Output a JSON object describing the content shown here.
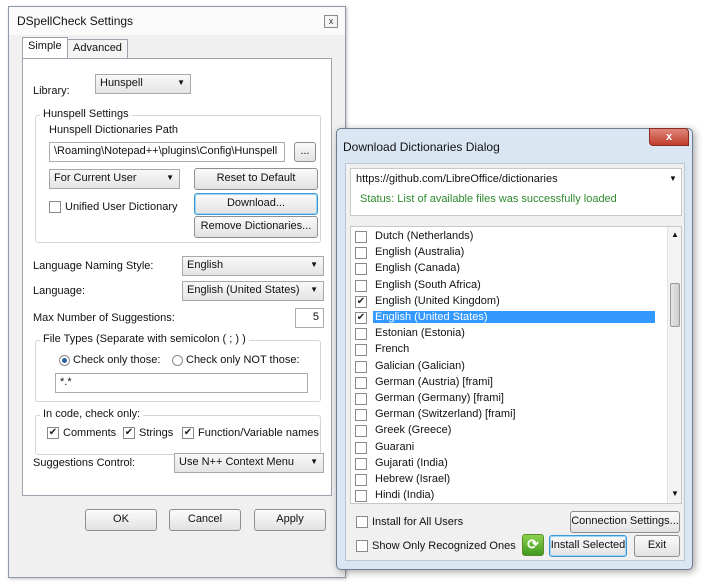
{
  "settings": {
    "title": "DSpellCheck Settings",
    "close_label": "x",
    "tabs": [
      "Simple",
      "Advanced"
    ],
    "library_label": "Library:",
    "library_value": "Hunspell",
    "hunspell_group": "Hunspell Settings",
    "dict_path_label": "Hunspell Dictionaries Path",
    "dict_path_value": "\\Roaming\\Notepad++\\plugins\\Config\\Hunspell",
    "browse_label": "...",
    "scope_value": "For Current User",
    "reset_label": "Reset to Default",
    "download_label": "Download...",
    "unified_label": "Unified User Dictionary",
    "remove_label": "Remove Dictionaries...",
    "lang_naming_label": "Language Naming Style:",
    "lang_naming_value": "English",
    "language_label": "Language:",
    "language_value": "English (United States)",
    "max_suggestions_label": "Max Number of Suggestions:",
    "max_suggestions_value": "5",
    "file_types_group": "File Types (Separate with semicolon ( ; ) )",
    "check_only_label": "Check only those:",
    "check_not_label": "Check only NOT those:",
    "file_types_value": "*.*",
    "code_group": "In code, check only:",
    "comments_label": "Comments",
    "strings_label": "Strings",
    "func_names_label": "Function/Variable names",
    "suggestions_control_label": "Suggestions Control:",
    "suggestions_control_value": "Use N++ Context Menu",
    "ok_label": "OK",
    "cancel_label": "Cancel",
    "apply_label": "Apply"
  },
  "download": {
    "title": "Download Dictionaries Dialog",
    "close_label": "x",
    "url_value": "https://github.com/LibreOffice/dictionaries",
    "status_text": "Status: List of available files was successfully loaded",
    "items": [
      {
        "label": "Dutch (Netherlands)",
        "checked": false,
        "selected": false
      },
      {
        "label": "English (Australia)",
        "checked": false,
        "selected": false
      },
      {
        "label": "English (Canada)",
        "checked": false,
        "selected": false
      },
      {
        "label": "English (South Africa)",
        "checked": false,
        "selected": false
      },
      {
        "label": "English (United Kingdom)",
        "checked": true,
        "selected": false
      },
      {
        "label": "English (United States)",
        "checked": true,
        "selected": true
      },
      {
        "label": "Estonian (Estonia)",
        "checked": false,
        "selected": false
      },
      {
        "label": "French",
        "checked": false,
        "selected": false
      },
      {
        "label": "Galician (Galician)",
        "checked": false,
        "selected": false
      },
      {
        "label": "German (Austria) [frami]",
        "checked": false,
        "selected": false
      },
      {
        "label": "German (Germany) [frami]",
        "checked": false,
        "selected": false
      },
      {
        "label": "German (Switzerland) [frami]",
        "checked": false,
        "selected": false
      },
      {
        "label": "Greek (Greece)",
        "checked": false,
        "selected": false
      },
      {
        "label": "Guarani",
        "checked": false,
        "selected": false
      },
      {
        "label": "Gujarati (India)",
        "checked": false,
        "selected": false
      },
      {
        "label": "Hebrew (Israel)",
        "checked": false,
        "selected": false
      },
      {
        "label": "Hindi (India)",
        "checked": false,
        "selected": false
      }
    ],
    "install_all_label": "Install for All Users",
    "connection_label": "Connection Settings...",
    "show_recognized_label": "Show Only Recognized Ones",
    "install_selected_label": "Install Selected",
    "exit_label": "Exit"
  },
  "colors": {
    "status_green": "#2e8b2e",
    "selection_blue": "#3399ff",
    "close_red": "#c13e2d"
  }
}
